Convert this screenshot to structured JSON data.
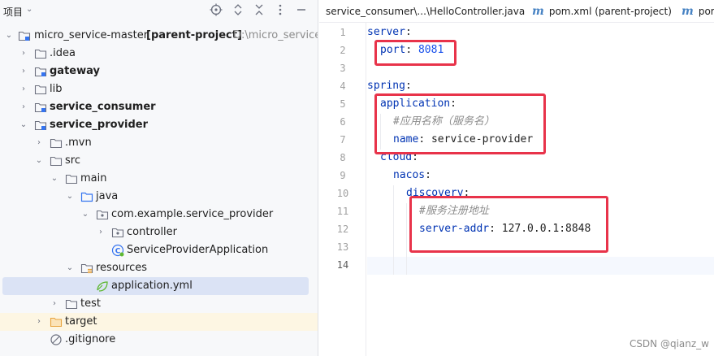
{
  "project_panel": {
    "title": "项目",
    "tree": [
      {
        "label": "micro_service-master",
        "extra": "[parent-project]",
        "path": "D:\\micro_service-",
        "expanded": true
      },
      {
        "label": ".idea"
      },
      {
        "label": "gateway"
      },
      {
        "label": "lib"
      },
      {
        "label": "service_consumer"
      },
      {
        "label": "service_provider",
        "expanded": true
      },
      {
        "label": ".mvn"
      },
      {
        "label": "src",
        "expanded": true
      },
      {
        "label": "main",
        "expanded": true
      },
      {
        "label": "java",
        "expanded": true
      },
      {
        "label": "com.example.service_provider",
        "expanded": true
      },
      {
        "label": "controller"
      },
      {
        "label": "ServiceProviderApplication"
      },
      {
        "label": "resources",
        "expanded": true
      },
      {
        "label": "application.yml",
        "selected": true
      },
      {
        "label": "test"
      },
      {
        "label": "target"
      },
      {
        "label": ".gitignore"
      }
    ]
  },
  "editor": {
    "tabs": [
      {
        "label": "service_consumer\\...\\HelloController.java"
      },
      {
        "label": "pom.xml (parent-project)",
        "icon": "m"
      },
      {
        "label": "pom",
        "icon": "m"
      }
    ],
    "line_numbers": [
      "1",
      "2",
      "3",
      "4",
      "5",
      "6",
      "7",
      "8",
      "9",
      "10",
      "11",
      "12",
      "13",
      "14"
    ],
    "current_line": "14",
    "code": {
      "l1_key": "server",
      "l2_key": "port",
      "l2_val": "8081",
      "l4_key": "spring",
      "l5_key": "application",
      "l6_comment": "#应用名称（服务名）",
      "l7_key": "name",
      "l7_val": "service-provider",
      "l8_key": "cloud",
      "l9_key": "nacos",
      "l10_key": "discovery",
      "l11_comment": "#服务注册地址",
      "l12_key": "server-addr",
      "l12_val": "127.0.0.1:8848"
    }
  },
  "watermark": "CSDN @qianz_w",
  "colors": {
    "highlight_box": "#e8334a",
    "yaml_key": "#0033b3",
    "yaml_value": "#067d17",
    "yaml_number": "#1750eb",
    "comment": "#8c8c8c",
    "selection": "#dbe3f5",
    "excluded_folder_bg": "#fdf6e3"
  }
}
